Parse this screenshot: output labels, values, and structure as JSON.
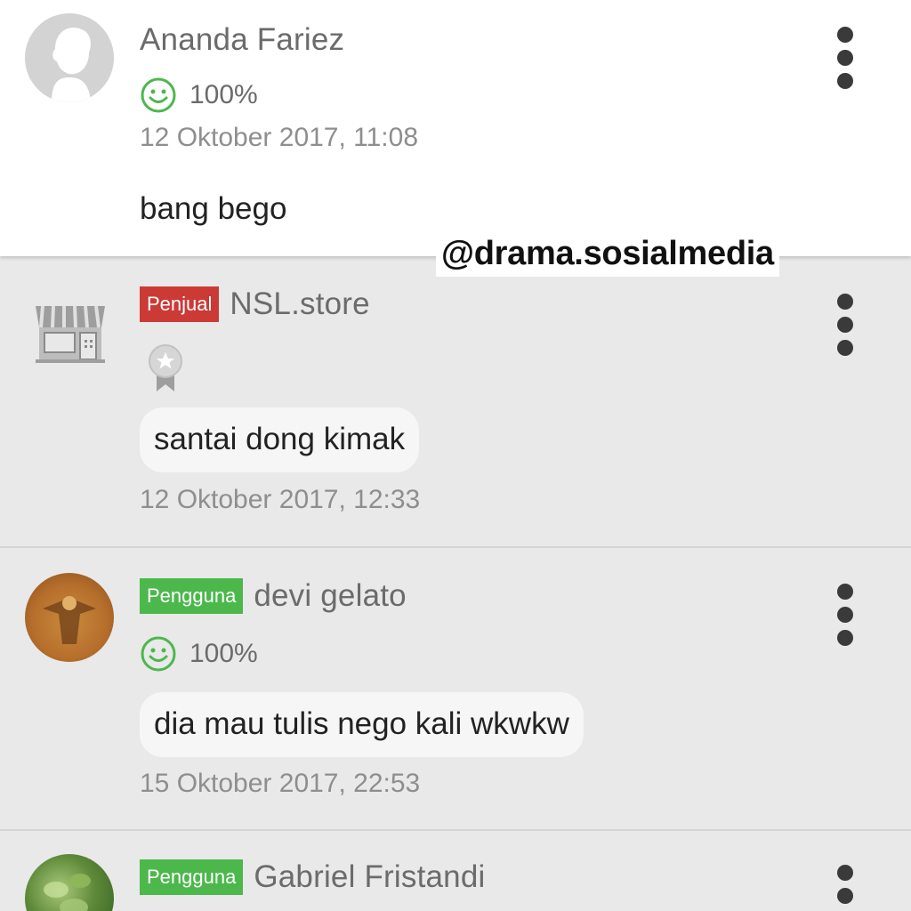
{
  "watermark": "@drama.sosialmedia",
  "comments": [
    {
      "name": "Ananda Fariez",
      "rating": "100%",
      "timestamp": "12 Oktober 2017, 11:08",
      "message": "bang bego"
    },
    {
      "badge": "Penjual",
      "name": "NSL.store",
      "message": "santai dong kimak",
      "timestamp": "12 Oktober 2017, 12:33"
    },
    {
      "badge": "Pengguna",
      "name": "devi gelato",
      "rating": "100%",
      "message": "dia mau tulis nego kali wkwkw",
      "timestamp": "15 Oktober 2017, 22:53"
    },
    {
      "badge": "Pengguna",
      "name": "Gabriel Fristandi"
    }
  ],
  "colors": {
    "seller_badge": "#cc3a36",
    "user_badge": "#4cb84c",
    "rating_icon": "#4cb84c"
  },
  "icons": {
    "menu": "more-vertical-icon",
    "rating": "smiley-icon",
    "store": "store-icon",
    "medal": "medal-icon"
  }
}
